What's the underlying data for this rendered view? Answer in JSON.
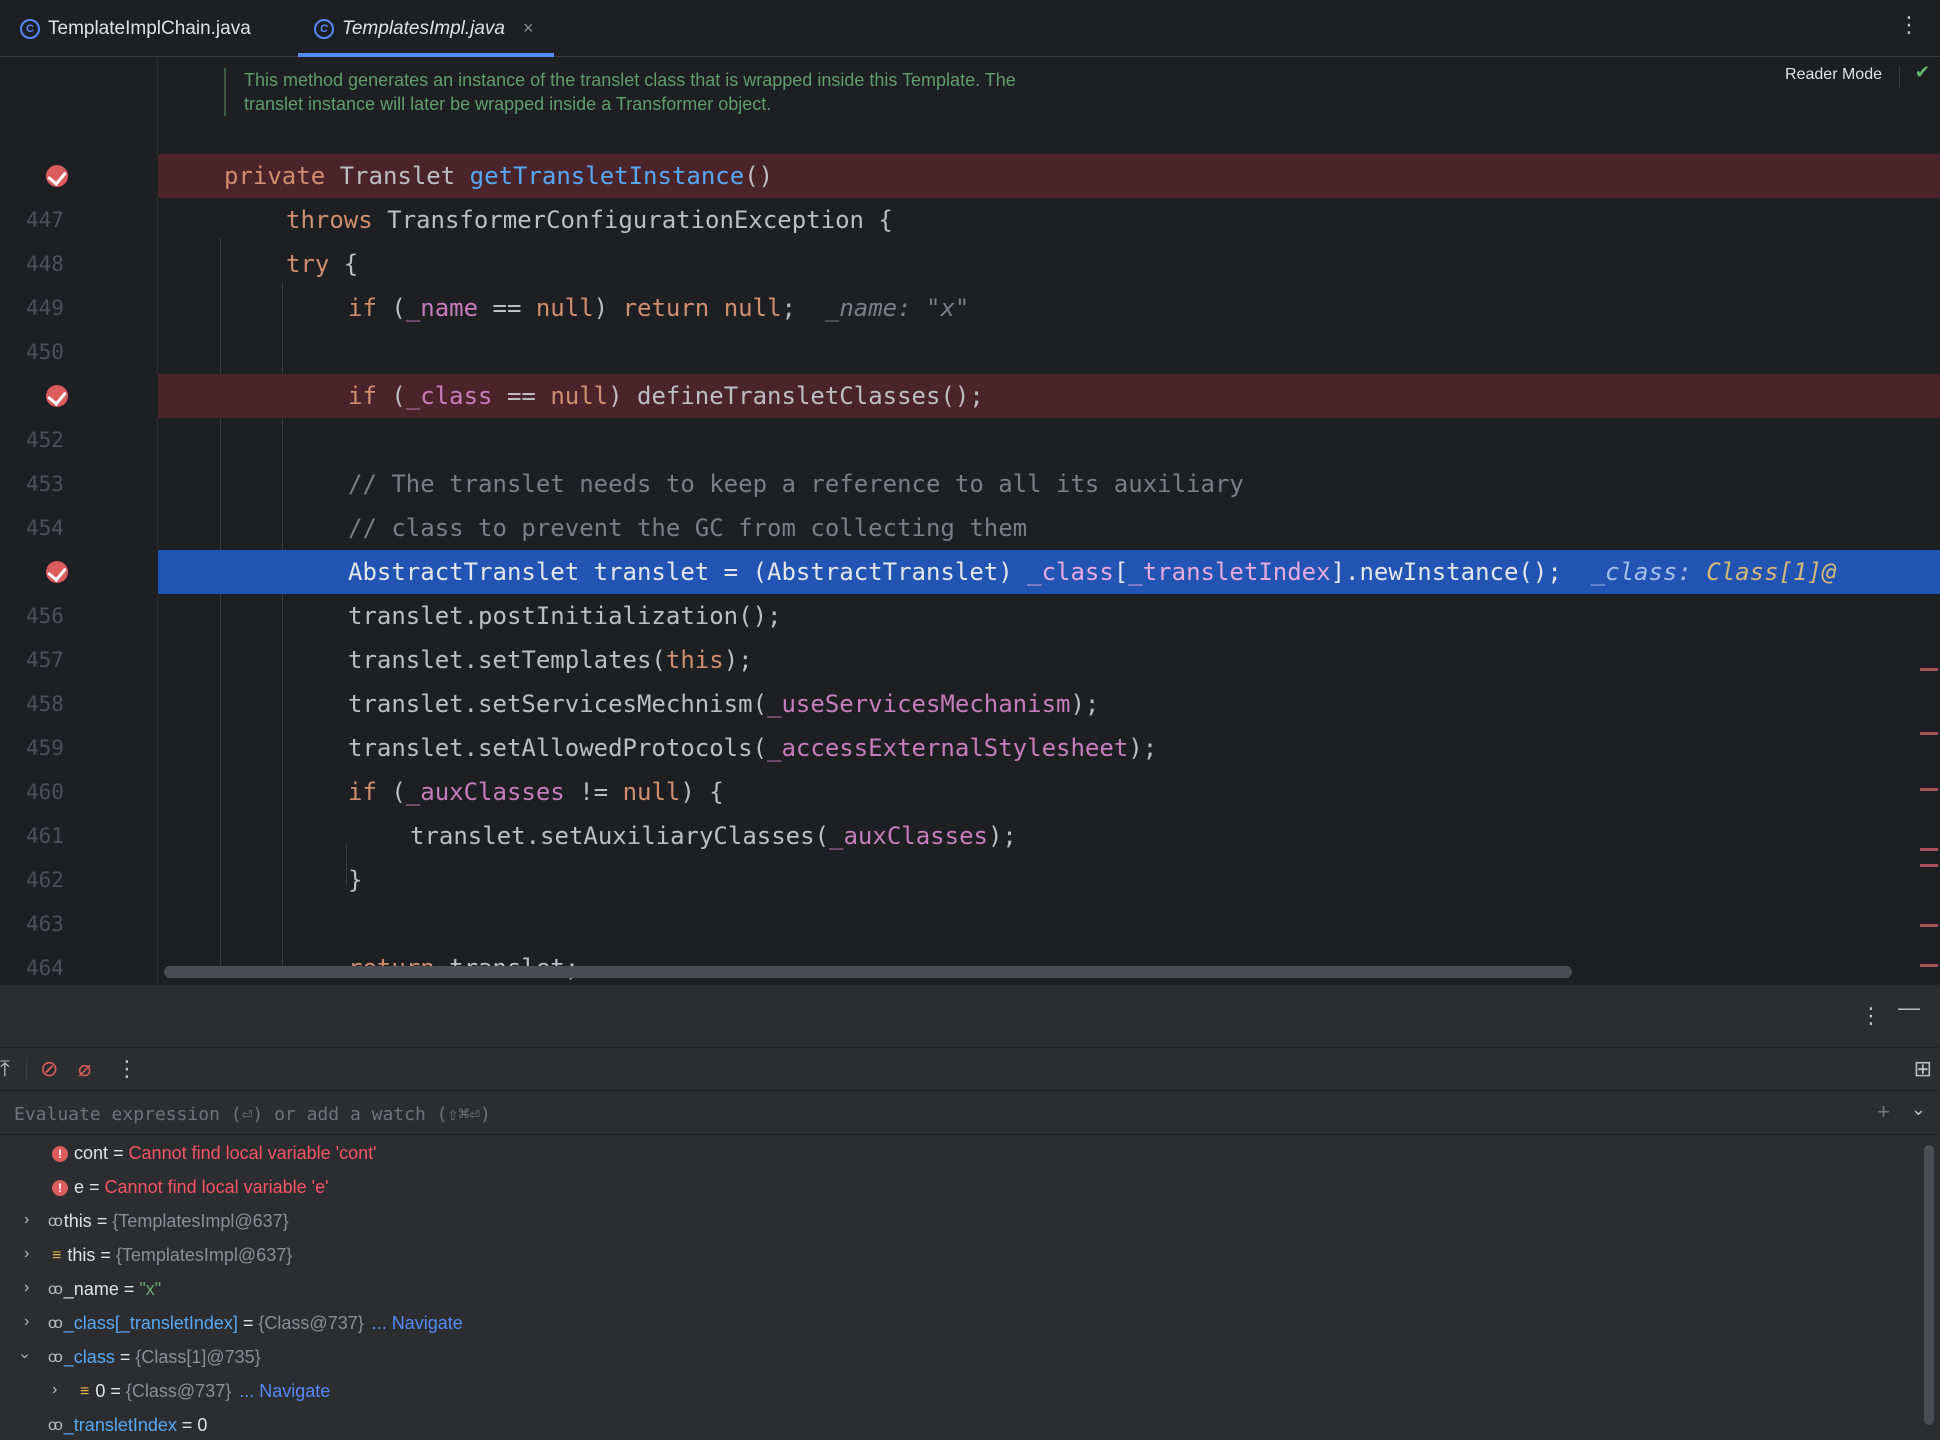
{
  "tabs": [
    {
      "label": "TemplateImplChain.java",
      "icon": "class-icon",
      "active": false
    },
    {
      "label": "TemplatesImpl.java",
      "icon": "class-icon",
      "active": true,
      "close": "×"
    }
  ],
  "editor": {
    "doc_line1": "This method generates an instance of the translet class that is wrapped inside this Template. The",
    "doc_line2": "translet instance will later be wrapped inside a Transformer object.",
    "reader_mode": "Reader Mode",
    "line_numbers": [
      "447",
      "448",
      "449",
      "450",
      "452",
      "453",
      "454",
      "456",
      "457",
      "458",
      "459",
      "460",
      "461",
      "462",
      "463",
      "464"
    ],
    "code": {
      "l446_kw": "private",
      "l446_type": " Translet ",
      "l446_fn": "getTransletInstance",
      "l446_rest": "()",
      "l447_kw": "throws",
      "l447_rest": " TransformerConfigurationException {",
      "l448_kw": "try",
      "l448_rest": " {",
      "l449_a": "if",
      "l449_b": " (",
      "l449_c": "_name",
      "l449_d": " == ",
      "l449_e": "null",
      "l449_f": ") ",
      "l449_g": "return",
      "l449_h": " ",
      "l449_i": "null",
      "l449_j": ";",
      "l449_hint": "_name: \"x\"",
      "l451_a": "if",
      "l451_b": " (",
      "l451_c": "_class",
      "l451_d": " == ",
      "l451_e": "null",
      "l451_f": ") defineTransletClasses();",
      "l453": "// The translet needs to keep a reference to all its auxiliary",
      "l454": "// class to prevent the GC from collecting them",
      "l455_a": "AbstractTranslet translet = (AbstractTranslet) ",
      "l455_b": "_class",
      "l455_c": "[",
      "l455_d": "_transletIndex",
      "l455_e": "].newInstance();",
      "l455_hint": "_class: ",
      "l455_hint_val": "Class[1]@",
      "l456": "translet.postInitialization();",
      "l457_a": "translet.setTemplates(",
      "l457_b": "this",
      "l457_c": ");",
      "l458_a": "translet.setServicesMechnism(",
      "l458_b": "_useServicesMechanism",
      "l458_c": ");",
      "l459_a": "translet.setAllowedProtocols(",
      "l459_b": "_accessExternalStylesheet",
      "l459_c": ");",
      "l460_a": "if",
      "l460_b": " (",
      "l460_c": "_auxClasses",
      "l460_d": " != ",
      "l460_e": "null",
      "l460_f": ") {",
      "l461_a": "translet.setAuxiliaryClasses(",
      "l461_b": "_auxClasses",
      "l461_c": ");",
      "l462": "}",
      "l464_a": "return",
      "l464_b": " translet;"
    }
  },
  "debugger": {
    "more": "⋮",
    "minimize": "—",
    "eval_placeholder": "Evaluate expression (⏎) or add a watch (⇧⌘⏎)",
    "variables": [
      {
        "kind": "error",
        "name": "cont",
        "eq": " = ",
        "value": "Cannot find local variable 'cont'"
      },
      {
        "kind": "error",
        "name": "e",
        "eq": " = ",
        "value": "Cannot find local variable 'e'"
      },
      {
        "kind": "watch",
        "name": "this",
        "eq": " = ",
        "value": "{TemplatesImpl@637}"
      },
      {
        "kind": "list",
        "name": "this",
        "eq": " = ",
        "value": "{TemplatesImpl@637}"
      },
      {
        "kind": "watch",
        "name": "_name",
        "eq": " = ",
        "value": "\"x\""
      },
      {
        "kind": "watch",
        "name": "_class[_transletIndex]",
        "eq": " = ",
        "value": "{Class@737}",
        "nav": "... Navigate"
      },
      {
        "kind": "watch",
        "name": "_class",
        "eq": " = ",
        "value": "{Class[1]@735}"
      },
      {
        "kind": "list",
        "name": "0",
        "eq": " = ",
        "value": "{Class@737}",
        "nav": "... Navigate"
      },
      {
        "kind": "watch",
        "name": "_transletIndex",
        "eq": " = ",
        "value": "0"
      }
    ]
  },
  "colors": {
    "breakpoint_line": "#4a242a",
    "execution_line": "#2154b3",
    "keyword": "#cf8e6d",
    "field": "#c77dbb",
    "function": "#56a8f5"
  }
}
